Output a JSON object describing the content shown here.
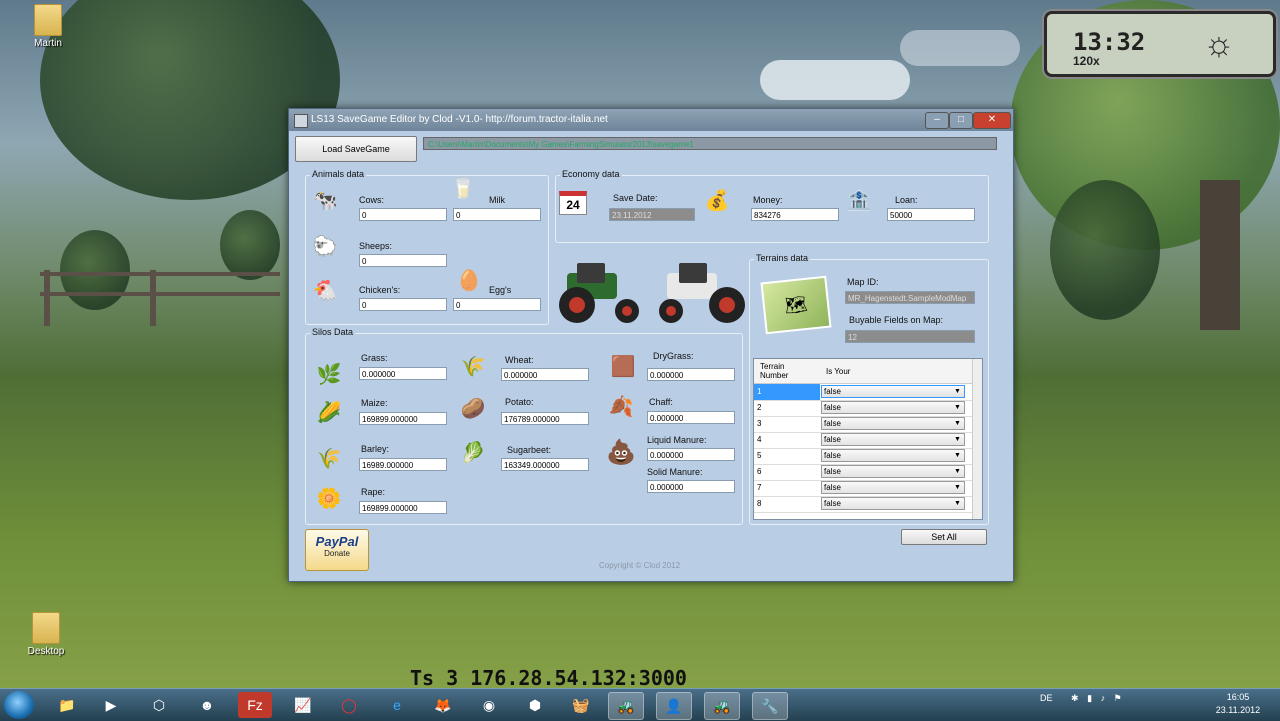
{
  "desktop": {
    "icons": [
      {
        "label": "Martin"
      },
      {
        "label": "Desktop"
      }
    ],
    "clock_widget": {
      "time": "13:32",
      "speed": "120x"
    },
    "overlay_text": "Ts 3    176.28.54.132:3000"
  },
  "window": {
    "title": "LS13 SaveGame Editor by Clod -V1.0- http://forum.tractor-italia.net",
    "load_button": "Load SaveGame",
    "path": "C:\\Users\\Martin\\Documents\\My Games\\FarmingSimulator2013\\savegame1",
    "animals": {
      "title": "Animals data",
      "cows": {
        "label": "Cows:",
        "value": "0"
      },
      "milk": {
        "label": "Milk",
        "value": "0"
      },
      "sheeps": {
        "label": "Sheeps:",
        "value": "0"
      },
      "chickens": {
        "label": "Chicken's:",
        "value": "0"
      },
      "eggs": {
        "label": "Egg's",
        "value": "0"
      }
    },
    "economy": {
      "title": "Economy data",
      "save_date": {
        "label": "Save Date:",
        "value": "23.11.2012"
      },
      "calendar_day": "24",
      "money": {
        "label": "Money:",
        "value": "834276"
      },
      "loan": {
        "label": "Loan:",
        "value": "50000"
      }
    },
    "terrains": {
      "title": "Terrains data",
      "map_id": {
        "label": "Map ID:",
        "value": "MR_Hagenstedt.SampleModMap"
      },
      "buyable": {
        "label": "Buyable Fields on Map:",
        "value": "12"
      },
      "grid": {
        "col1": "Terrain Number",
        "col2": "Is Your",
        "rows": [
          {
            "num": "1",
            "value": "false"
          },
          {
            "num": "2",
            "value": "false"
          },
          {
            "num": "3",
            "value": "false"
          },
          {
            "num": "4",
            "value": "false"
          },
          {
            "num": "5",
            "value": "false"
          },
          {
            "num": "6",
            "value": "false"
          },
          {
            "num": "7",
            "value": "false"
          },
          {
            "num": "8",
            "value": "false"
          }
        ]
      },
      "set_all": "Set All"
    },
    "silos": {
      "title": "Silos Data",
      "grass": {
        "label": "Grass:",
        "value": "0.000000"
      },
      "maize": {
        "label": "Maize:",
        "value": "169899.000000"
      },
      "barley": {
        "label": "Barley:",
        "value": "16989.000000"
      },
      "rape": {
        "label": "Rape:",
        "value": "169899.000000"
      },
      "wheat": {
        "label": "Wheat:",
        "value": "0.000000"
      },
      "potato": {
        "label": "Potato:",
        "value": "176789.000000"
      },
      "sugarbeet": {
        "label": "Sugarbeet:",
        "value": "163349.000000"
      },
      "drygrass": {
        "label": "DryGrass:",
        "value": "0.000000"
      },
      "chaff": {
        "label": "Chaff:",
        "value": "0.000000"
      },
      "liquid_manure": {
        "label": "Liquid Manure:",
        "value": "0.000000"
      },
      "solid_manure": {
        "label": "Solid Manure:",
        "value": "0.000000"
      }
    },
    "paypal": {
      "brand": "PayPal",
      "action": "Donate"
    },
    "copyright": "Copyright © Clod 2012"
  },
  "taskbar": {
    "tray_lang": "DE",
    "time": "16:05",
    "date": "23.11.2012"
  }
}
